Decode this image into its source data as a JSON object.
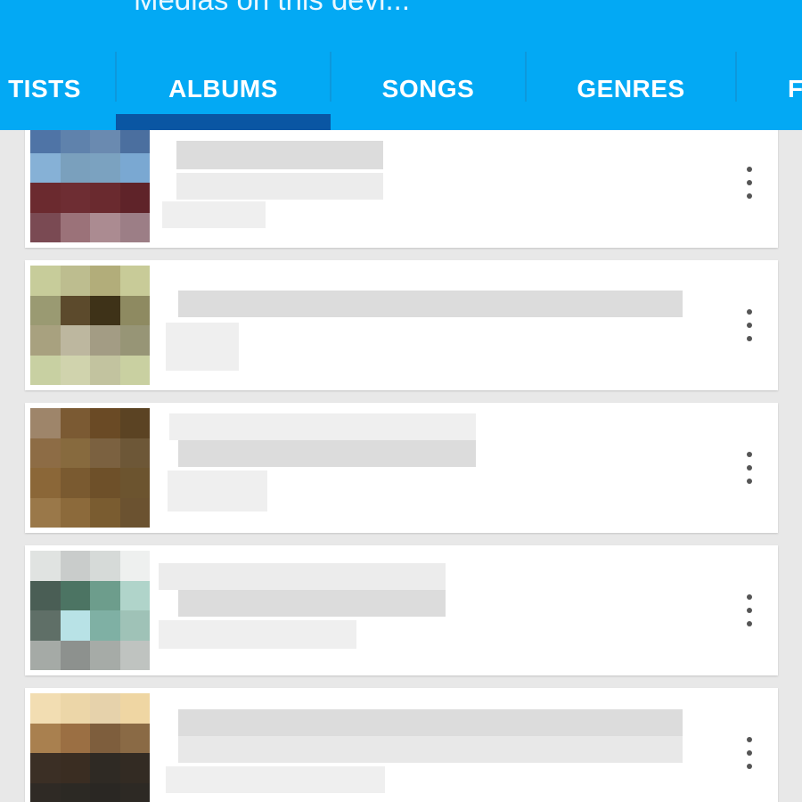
{
  "app_title": "Medias on this devi...",
  "tabs": [
    {
      "label": "TISTS",
      "active": false
    },
    {
      "label": "ALBUMS",
      "active": true
    },
    {
      "label": "SONGS",
      "active": false
    },
    {
      "label": "GENRES",
      "active": false
    },
    {
      "label": "F",
      "active": false
    }
  ],
  "colors": {
    "accent": "#03a9f4",
    "tab_indicator": "#0a56a3",
    "background": "#e8e8e8",
    "card": "#ffffff"
  },
  "albums": [
    {
      "art_colors": [
        [
          "#4f74a6",
          "#5f82ac",
          "#6a8ab0",
          "#4b6f9f"
        ],
        [
          "#86b1d6",
          "#7aa0bd",
          "#7ba2c0",
          "#7aa8d2"
        ],
        [
          "#6b2a2f",
          "#6e2d33",
          "#6a2a2f",
          "#5f2329"
        ],
        [
          "#7a4a53",
          "#9b7279",
          "#ab8b91",
          "#9c7e86"
        ]
      ],
      "menu_icon": "more-vert-icon"
    },
    {
      "art_colors": [
        [
          "#c7cc9a",
          "#bdbd8f",
          "#b2ad7a",
          "#c8cb98"
        ],
        [
          "#9a9a72",
          "#5c4a2c",
          "#3e3218",
          "#8e8a61"
        ],
        [
          "#a8a17f",
          "#bdb79f",
          "#a39c84",
          "#979576"
        ],
        [
          "#c8d0a2",
          "#d0d3ad",
          "#c2c39f",
          "#c9d0a1"
        ]
      ],
      "menu_icon": "more-vert-icon"
    },
    {
      "art_colors": [
        [
          "#9e856a",
          "#7b5a33",
          "#6a4a25",
          "#5b4323"
        ],
        [
          "#8d6c45",
          "#876a3e",
          "#7b6140",
          "#6d5737"
        ],
        [
          "#8b6738",
          "#7a5a30",
          "#6e5029",
          "#6c542f"
        ],
        [
          "#9a7849",
          "#8c6a3b",
          "#7a5c30",
          "#6b5230"
        ]
      ],
      "menu_icon": "more-vert-icon"
    },
    {
      "art_colors": [
        [
          "#e0e3e1",
          "#c9cccb",
          "#d6dad8",
          "#eef0ef"
        ],
        [
          "#4a5e55",
          "#4c7463",
          "#6d9d8c",
          "#b0d4ca"
        ],
        [
          "#5f6f67",
          "#b8e2e6",
          "#7fb0a4",
          "#9fc2b7"
        ],
        [
          "#a5aaa6",
          "#8d918e",
          "#a6aba7",
          "#bfc3c0"
        ]
      ],
      "menu_icon": "more-vert-icon"
    },
    {
      "art_colors": [
        [
          "#f2ddb2",
          "#ecd6a8",
          "#e6d2ab",
          "#efd6a3"
        ],
        [
          "#a9804f",
          "#9b6f43",
          "#7e5e3d",
          "#8a6a45"
        ],
        [
          "#3b2f25",
          "#3a2d22",
          "#2f2a24",
          "#332b23"
        ],
        [
          "#2f2a25",
          "#2c2924",
          "#2a2723",
          "#2d2924"
        ]
      ],
      "menu_icon": "more-vert-icon"
    }
  ]
}
